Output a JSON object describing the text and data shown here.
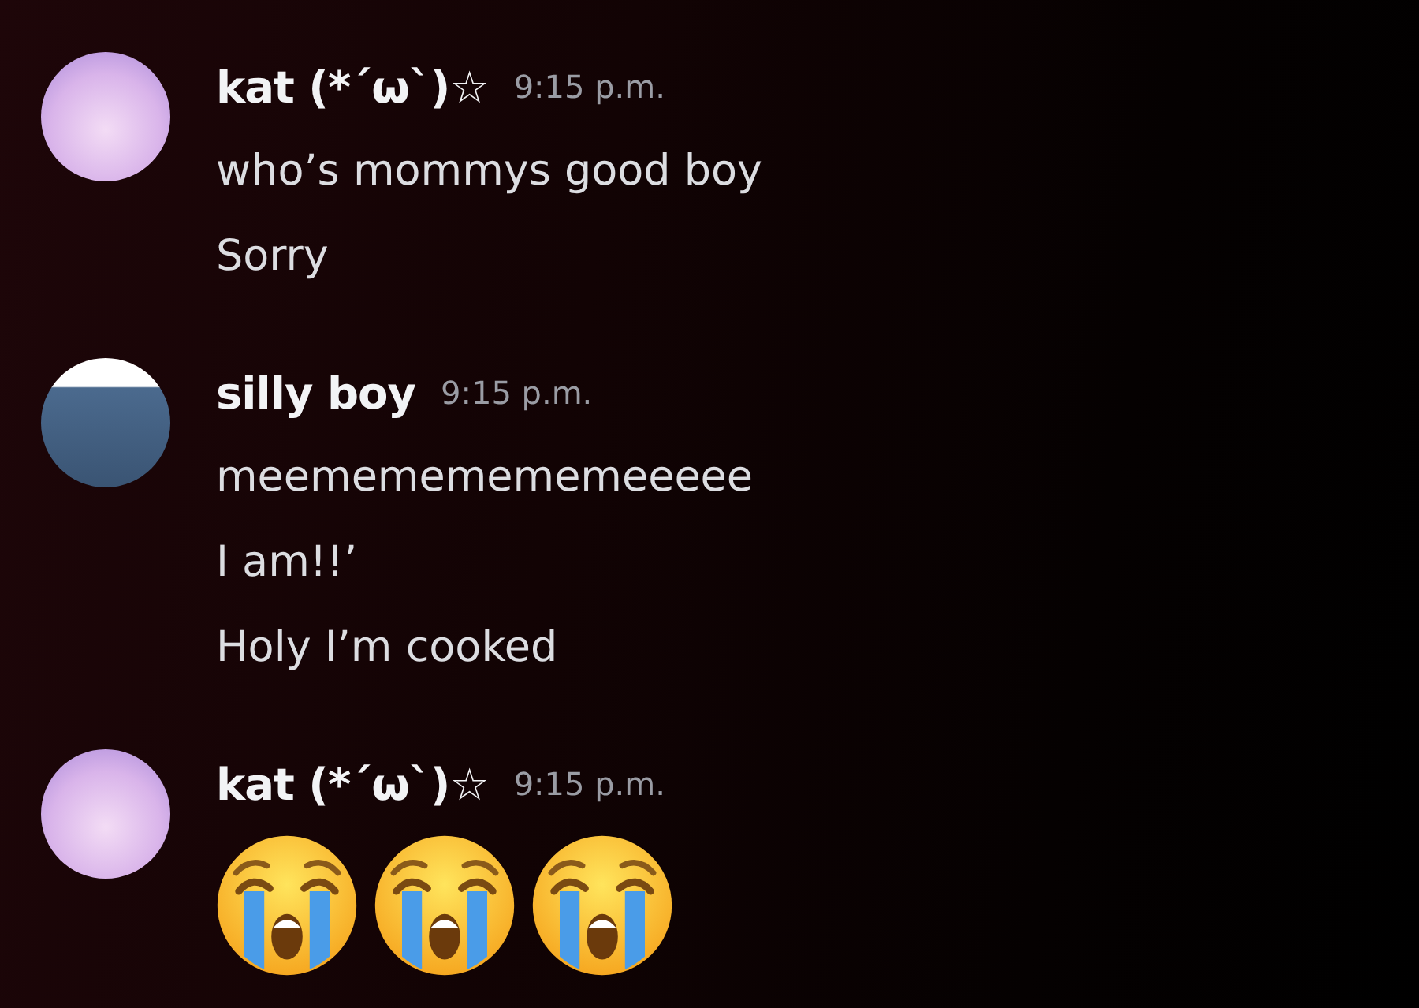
{
  "messages": [
    {
      "avatar": {
        "kind": "pastel-drawing"
      },
      "author": "kat (*´ω`)☆",
      "time": "9:15 p.m.",
      "lines": [
        {
          "kind": "text",
          "text": "who’s mommys good boy"
        },
        {
          "kind": "text",
          "text": "Sorry"
        }
      ]
    },
    {
      "avatar": {
        "kind": "meme-photo"
      },
      "author": "silly boy",
      "time": "9:15 p.m.",
      "lines": [
        {
          "kind": "text",
          "text": "meemememememeeeee"
        },
        {
          "kind": "text",
          "text": "I am!!’"
        },
        {
          "kind": "text",
          "text": "Holy I’m cooked"
        }
      ]
    },
    {
      "avatar": {
        "kind": "pastel-drawing"
      },
      "author": "kat (*´ω`)☆",
      "time": "9:15 p.m.",
      "lines": [
        {
          "kind": "emoji",
          "emojis": [
            {
              "kind": "loudly-crying"
            },
            {
              "kind": "loudly-crying"
            },
            {
              "kind": "loudly-crying"
            }
          ]
        }
      ]
    }
  ]
}
